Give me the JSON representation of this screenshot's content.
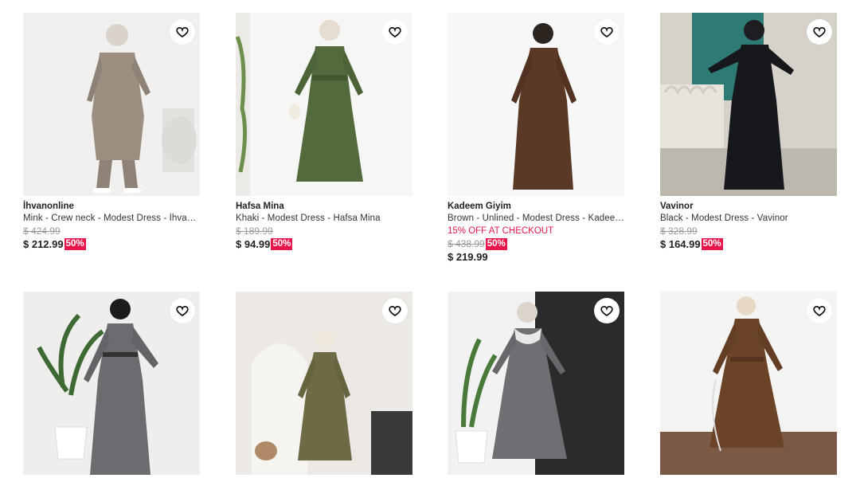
{
  "colors": {
    "accent": "#e8174b",
    "old_price": "#999999"
  },
  "icons": {
    "favorite": "heart-outline-icon"
  },
  "products": [
    {
      "brand": "İhvanonline",
      "name": "Mink - Crew neck - Modest Dress - İhvanonline",
      "promo": "",
      "old_price": "$ 424.99",
      "price": "$ 212.99",
      "discount": "50%",
      "final_price": ""
    },
    {
      "brand": "Hafsa Mina",
      "name": "Khaki - Modest Dress - Hafsa Mina",
      "promo": "",
      "old_price": "$ 189.99",
      "price": "$ 94.99",
      "discount": "50%",
      "final_price": ""
    },
    {
      "brand": "Kadeem Giyim",
      "name": "Brown - Unlined - Modest Dress - Kadeem Giyim",
      "promo": "15% OFF AT CHECKOUT",
      "old_price": "$ 438.99",
      "price": "",
      "discount": "50%",
      "final_price": "$ 219.99"
    },
    {
      "brand": "Vavinor",
      "name": "Black - Modest Dress - Vavinor",
      "promo": "",
      "old_price": "$ 328.99",
      "price": "$ 164.99",
      "discount": "50%",
      "final_price": ""
    },
    {
      "brand": "",
      "name": "",
      "promo": "",
      "old_price": "",
      "price": "",
      "discount": "",
      "final_price": ""
    },
    {
      "brand": "",
      "name": "",
      "promo": "",
      "old_price": "",
      "price": "",
      "discount": "",
      "final_price": ""
    },
    {
      "brand": "",
      "name": "",
      "promo": "",
      "old_price": "",
      "price": "",
      "discount": "",
      "final_price": ""
    },
    {
      "brand": "",
      "name": "",
      "promo": "",
      "old_price": "",
      "price": "",
      "discount": "",
      "final_price": ""
    }
  ]
}
